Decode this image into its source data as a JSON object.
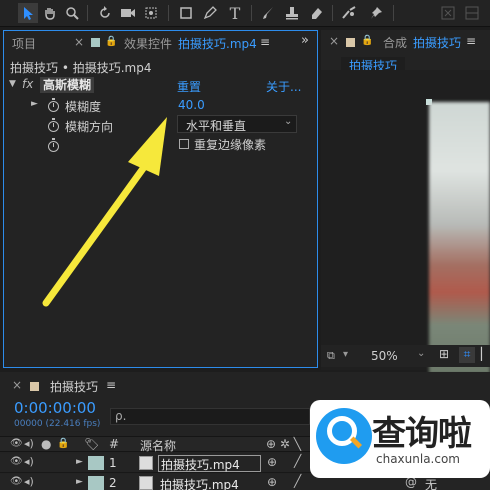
{
  "colors": {
    "accent": "#2d8ceb",
    "arrow": "#f6e83b",
    "swatch": "#a8c8c4"
  },
  "toolbar": {
    "tools": [
      "selection-icon",
      "hand-icon",
      "zoom-icon",
      "rotate-icon",
      "camera-icon",
      "pan-behind-icon",
      "rectangle-icon",
      "pen-icon",
      "type-icon",
      "brush-icon",
      "clone-stamp-icon",
      "eraser-icon",
      "roto-brush-icon",
      "puppet-pin-icon"
    ],
    "type_glyph": "T"
  },
  "effects_panel": {
    "project_tab": "项目",
    "tab_prefix": "效果控件",
    "tab_file": "拍摄技巧.mp4",
    "subtitle": "拍摄技巧 • 拍摄技巧.mp4",
    "effect": {
      "fx": "fx",
      "name": "高斯模糊",
      "reset": "重置",
      "about": "关于..."
    },
    "properties": [
      {
        "label": "模糊度",
        "value": "40.0"
      },
      {
        "label": "模糊方向",
        "value": "水平和垂直"
      },
      {
        "label": "重复边缘像素"
      }
    ]
  },
  "composition_panel": {
    "tab_prefix": "合成",
    "tab_name": "拍摄技巧",
    "breadcrumb": "拍摄技巧",
    "zoom": "50%"
  },
  "timeline": {
    "tab_name": "拍摄技巧",
    "timecode": "0:00:00:00",
    "fps_info": "00000 (22.416 fps)",
    "search_placeholder": "ρ.",
    "columns": {
      "num": "#",
      "source": "源名称"
    },
    "layers": [
      {
        "num": "1",
        "name": "拍摄技巧.mp4"
      },
      {
        "num": "2",
        "name": "拍摄技巧.mp4",
        "mode": "无"
      }
    ]
  },
  "watermark": {
    "title": "查询啦",
    "url": "chaxunla.com"
  }
}
